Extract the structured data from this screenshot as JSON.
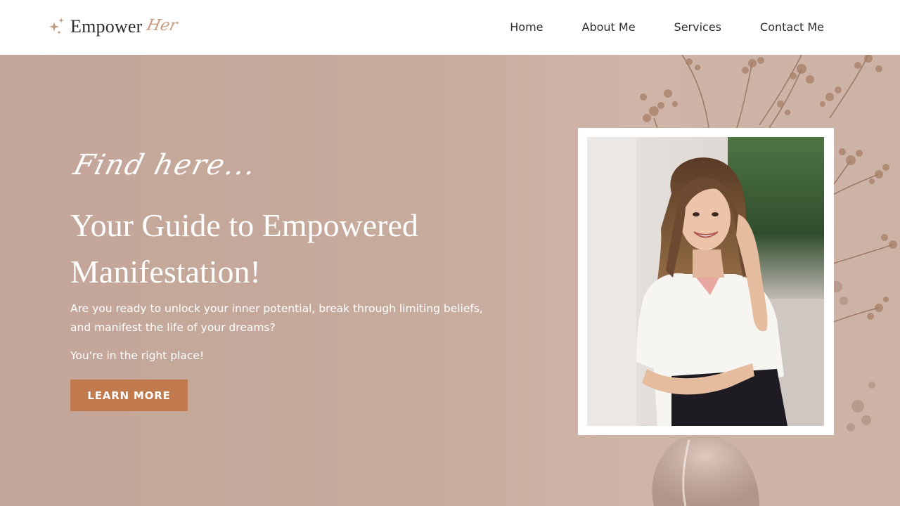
{
  "brand": {
    "name": "Empower",
    "script": "Her",
    "icon": "sparkle-icon"
  },
  "nav": {
    "items": [
      {
        "label": "Home"
      },
      {
        "label": "About Me"
      },
      {
        "label": "Services"
      },
      {
        "label": "Contact Me"
      }
    ]
  },
  "hero": {
    "eyebrow": "Find here...",
    "title": "Your Guide to Empowered Manifestation!",
    "paragraph": "Are you ready to unlock your inner potential, break through limiting beliefs, and manifest the life of your dreams?",
    "paragraph2": "You're in the right place!",
    "cta_label": "LEARN MORE"
  },
  "colors": {
    "background": "#c6aa9c",
    "accent": "#c07a4e",
    "text": "#2f2d2c",
    "script": "#c79a7e"
  }
}
